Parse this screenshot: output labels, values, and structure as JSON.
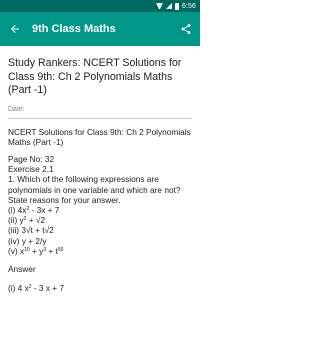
{
  "status_bar": {
    "time": "6:56",
    "icons": [
      "wifi-icon",
      "signal-icon",
      "battery-icon"
    ]
  },
  "app_bar": {
    "title": "9th Class Maths",
    "back_icon": "arrow-back-icon",
    "share_icon": "share-icon",
    "color": "#009688",
    "status_color": "#00695f"
  },
  "article": {
    "title": "Study Rankers: NCERT Solutions for Class 9th: Ch 2 Polynomials Maths (Part -1)",
    "date_label": "Date:",
    "intro": "NCERT Solutions for Class 9th: Ch 2 Polynomials Maths  (Part -1)",
    "page_no": "Page No: 32",
    "exercise": "Exercise 2.1",
    "question": "1. Which of the following expressions are polynomials in one variable and which are not? State reasons for your answer.",
    "items": [
      {
        "pre": "(i) 4x",
        "sup": "2",
        "post": " - 3x + 7"
      },
      {
        "pre": "(ii) y",
        "sup": "2",
        "post": " + √2"
      },
      {
        "pre": "(iii) 3√t + t√2",
        "sup": "",
        "post": ""
      },
      {
        "pre": "(iv) y + 2/y",
        "sup": "",
        "post": ""
      },
      {
        "pre": "(v) x",
        "sup": "10",
        "post": " + y",
        "sup2": "3",
        "post2": " + t",
        "sup3": "50"
      }
    ],
    "answer_label": "Answer",
    "answer_first": {
      "pre": "(i) 4 x",
      "sup": "2",
      "post": " - 3 x + 7"
    }
  }
}
